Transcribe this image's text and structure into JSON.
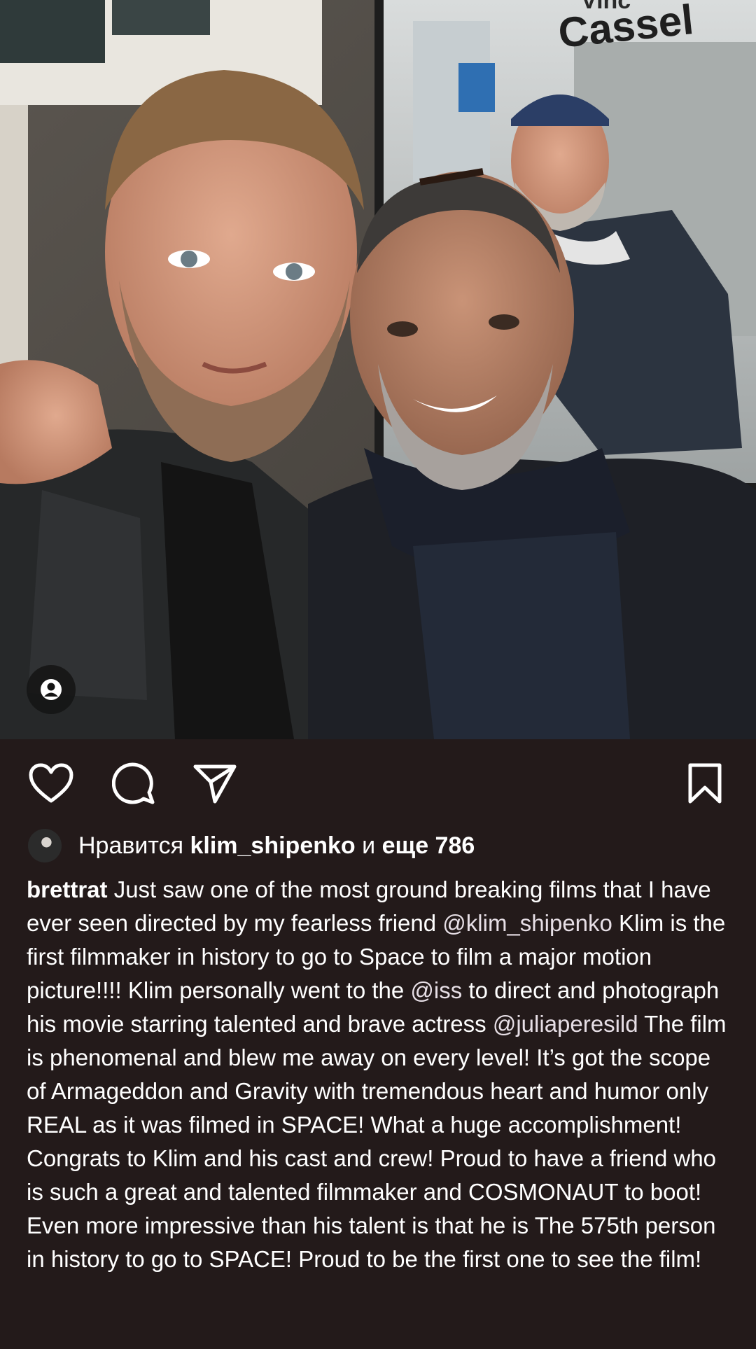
{
  "photo": {
    "poster_text_top": "Vinc",
    "poster_text_name": "Cassel"
  },
  "actions": {
    "like_icon": "heart-icon",
    "comment_icon": "comment-icon",
    "share_icon": "paper-plane-icon",
    "save_icon": "bookmark-icon",
    "tag_icon": "person-tag-icon"
  },
  "likes": {
    "prefix": "Нравится",
    "user": "klim_shipenko",
    "joiner": "и",
    "rest": "еще 786"
  },
  "caption": {
    "username": "brettrat",
    "part1": " Just saw one of the most ground breaking films that I have ever seen directed by my fearless friend ",
    "mention1": "@klim_shipenko",
    "part2": " Klim is the first filmmaker in history to go to Space to film a major motion picture!!!! Klim personally went to the ",
    "mention2": "@iss",
    "part3": " to direct and photograph his movie starring talented and brave actress ",
    "mention3": "@juliaperesild",
    "part4": " The film is phenomenal and blew me away on every level! It’s got the scope of Armageddon and Gravity with tremendous heart and humor only REAL as it was filmed in SPACE! What a huge accomplishment! Congrats to Klim and his cast and crew! Proud to have a friend who is such a great and talented filmmaker and COSMONAUT to boot! Even more impressive than his talent is that he is The 575th person in history to go to SPACE! Proud to be the first one to see the film!"
  },
  "colors": {
    "background": "#231a1a",
    "text": "#ffffff"
  }
}
